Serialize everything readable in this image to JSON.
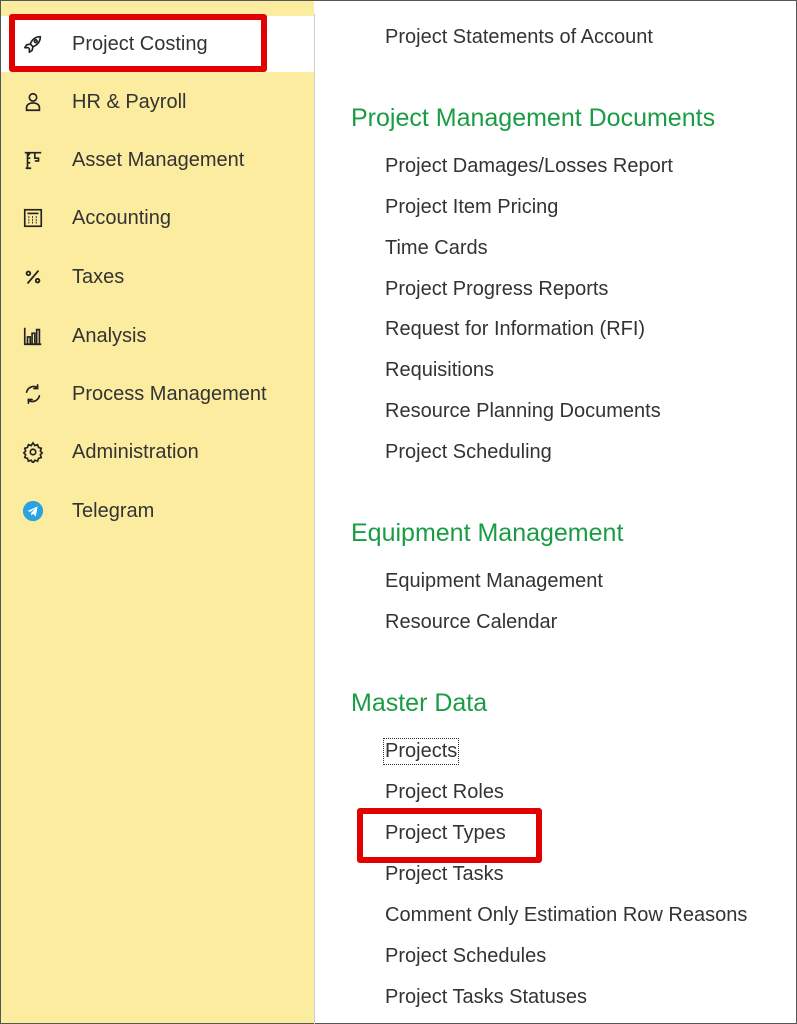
{
  "sidebar": {
    "items": [
      {
        "label": "Project Costing",
        "icon": "rocket-icon"
      },
      {
        "label": "HR & Payroll",
        "icon": "person-icon"
      },
      {
        "label": "Asset Management",
        "icon": "crane-icon"
      },
      {
        "label": "Accounting",
        "icon": "calculator-icon"
      },
      {
        "label": "Taxes",
        "icon": "percent-icon"
      },
      {
        "label": "Analysis",
        "icon": "bar-chart-icon"
      },
      {
        "label": "Process Management",
        "icon": "cycle-icon"
      },
      {
        "label": "Administration",
        "icon": "gear-icon"
      },
      {
        "label": "Telegram",
        "icon": "telegram-icon"
      }
    ],
    "active_index": 0
  },
  "content": {
    "top_link": "Project Statements of Account",
    "sections": [
      {
        "title": "Project Management Documents",
        "items": [
          "Project Damages/Losses Report",
          "Project Item Pricing",
          "Time Cards",
          "Project Progress Reports",
          "Request for Information (RFI)",
          "Requisitions",
          "Resource Planning Documents",
          "Project Scheduling"
        ]
      },
      {
        "title": "Equipment Management",
        "items": [
          "Equipment Management",
          "Resource Calendar"
        ]
      },
      {
        "title": "Master Data",
        "items": [
          "Projects",
          "Project Roles",
          "Project Types",
          "Project Tasks",
          "Comment Only Estimation Row Reasons",
          "Project Schedules",
          "Project Tasks Statuses"
        ]
      }
    ],
    "focused_item": "Projects"
  },
  "colors": {
    "sidebar_bg": "#fcec9f",
    "section_title": "#1a9c45",
    "highlight": "#e30000",
    "telegram": "#2aa3e0"
  }
}
